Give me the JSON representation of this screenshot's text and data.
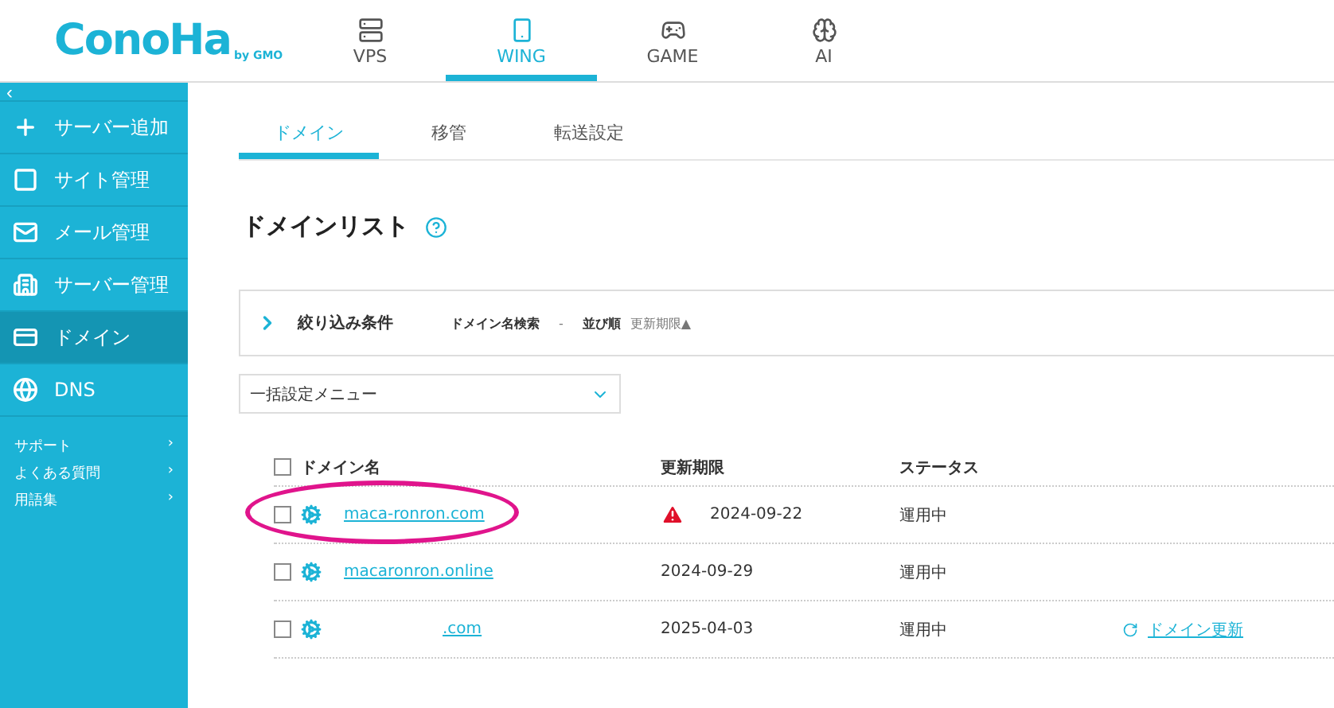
{
  "header": {
    "logo": "ConoHa",
    "logo_sub": "by GMO",
    "nav": [
      {
        "label": "VPS",
        "selected": false
      },
      {
        "label": "WING",
        "selected": true
      },
      {
        "label": "GAME",
        "selected": false
      },
      {
        "label": "AI",
        "selected": false
      }
    ]
  },
  "sidebar": {
    "collapse": "‹",
    "items": [
      {
        "label": "サーバー追加",
        "selected": false
      },
      {
        "label": "サイト管理",
        "selected": false
      },
      {
        "label": "メール管理",
        "selected": false
      },
      {
        "label": "サーバー管理",
        "selected": false
      },
      {
        "label": "ドメイン",
        "selected": true
      },
      {
        "label": "DNS",
        "selected": false
      }
    ],
    "links": [
      {
        "label": "サポート",
        "arrow": "›"
      },
      {
        "label": "よくある質問",
        "arrow": "›"
      },
      {
        "label": "用語集",
        "arrow": "›"
      }
    ]
  },
  "tabs": [
    {
      "label": "ドメイン",
      "selected": true
    },
    {
      "label": "移管",
      "selected": false
    },
    {
      "label": "転送設定",
      "selected": false
    }
  ],
  "title": "ドメインリスト",
  "filter": {
    "label": "絞り込み条件",
    "search": "ドメイン名検索",
    "search_value": "-",
    "sort_label": "並び順",
    "sort_value": "更新期限▲"
  },
  "bulk_menu": "一括設定メニュー",
  "table": {
    "columns": [
      "ドメイン名",
      "更新期限",
      "ステータス"
    ],
    "header_checked": false,
    "rows": [
      {
        "checked": false,
        "name": "maca-ronron.com",
        "warning": true,
        "expiry": "2024-09-22",
        "status": "運用中",
        "highlighted": true
      },
      {
        "checked": false,
        "name": "macaronron.online",
        "warning": false,
        "expiry": "2024-09-29",
        "status": "運用中",
        "highlighted": false
      },
      {
        "checked": false,
        "name": ".com",
        "warning": false,
        "expiry": "2025-04-03",
        "status": "運用中",
        "highlighted": false,
        "action": "ドメイン更新"
      }
    ]
  }
}
